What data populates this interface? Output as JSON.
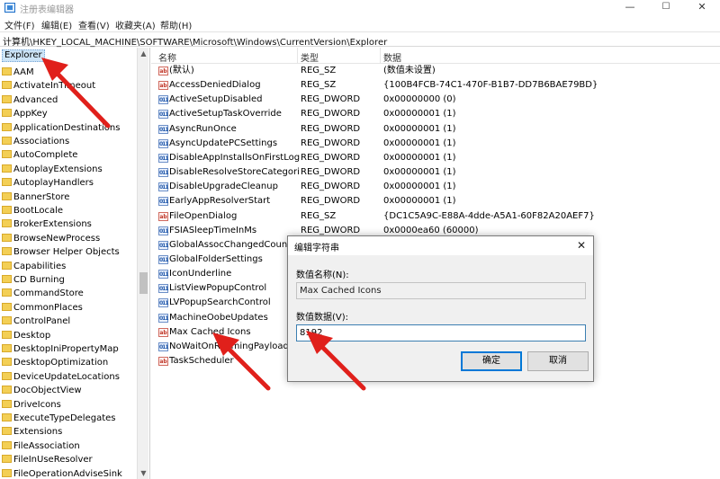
{
  "window": {
    "title": "注册表编辑器",
    "minimize": "—",
    "maximize": "☐",
    "close": "✕"
  },
  "menu": [
    "文件(F)",
    "编辑(E)",
    "查看(V)",
    "收藏夹(A)",
    "帮助(H)"
  ],
  "address": "计算机\\HKEY_LOCAL_MACHINE\\SOFTWARE\\Microsoft\\Windows\\CurrentVersion\\Explorer",
  "tree": {
    "root": "Explorer",
    "items": [
      "AAM",
      "ActivateInTimeout",
      "Advanced",
      "AppKey",
      "ApplicationDestinations",
      "Associations",
      "AutoComplete",
      "AutoplayExtensions",
      "AutoplayHandlers",
      "BannerStore",
      "BootLocale",
      "BrokerExtensions",
      "BrowseNewProcess",
      "Browser Helper Objects",
      "Capabilities",
      "CD Burning",
      "CommandStore",
      "CommonPlaces",
      "ControlPanel",
      "Desktop",
      "DesktopIniPropertyMap",
      "DesktopOptimization",
      "DeviceUpdateLocations",
      "DocObjectView",
      "DriveIcons",
      "ExecuteTypeDelegates",
      "Extensions",
      "FileAssociation",
      "FileInUseResolver",
      "FileOperationAdviseSink"
    ]
  },
  "list": {
    "headers": {
      "name": "名称",
      "type": "类型",
      "data": "数据"
    },
    "rows": [
      {
        "icon": "string-value-icon",
        "name": "(默认)",
        "type": "REG_SZ",
        "data": "(数值未设置)"
      },
      {
        "icon": "string-value-icon",
        "name": "AccessDeniedDialog",
        "type": "REG_SZ",
        "data": "{100B4FCB-74C1-470F-B1B7-DD7B6BAE79BD}"
      },
      {
        "icon": "binary-value-icon",
        "name": "ActiveSetupDisabled",
        "type": "REG_DWORD",
        "data": "0x00000000 (0)"
      },
      {
        "icon": "binary-value-icon",
        "name": "ActiveSetupTaskOverride",
        "type": "REG_DWORD",
        "data": "0x00000001 (1)"
      },
      {
        "icon": "binary-value-icon",
        "name": "AsyncRunOnce",
        "type": "REG_DWORD",
        "data": "0x00000001 (1)"
      },
      {
        "icon": "binary-value-icon",
        "name": "AsyncUpdatePCSettings",
        "type": "REG_DWORD",
        "data": "0x00000001 (1)"
      },
      {
        "icon": "binary-value-icon",
        "name": "DisableAppInstallsOnFirstLog...",
        "type": "REG_DWORD",
        "data": "0x00000001 (1)"
      },
      {
        "icon": "binary-value-icon",
        "name": "DisableResolveStoreCategori...",
        "type": "REG_DWORD",
        "data": "0x00000001 (1)"
      },
      {
        "icon": "binary-value-icon",
        "name": "DisableUpgradeCleanup",
        "type": "REG_DWORD",
        "data": "0x00000001 (1)"
      },
      {
        "icon": "binary-value-icon",
        "name": "EarlyAppResolverStart",
        "type": "REG_DWORD",
        "data": "0x00000001 (1)"
      },
      {
        "icon": "string-value-icon",
        "name": "FileOpenDialog",
        "type": "REG_SZ",
        "data": "{DC1C5A9C-E88A-4dde-A5A1-60F82A20AEF7}"
      },
      {
        "icon": "binary-value-icon",
        "name": "FSIASleepTimeInMs",
        "type": "REG_DWORD",
        "data": "0x0000ea60 (60000)"
      },
      {
        "icon": "binary-value-icon",
        "name": "GlobalAssocChangedCounter",
        "type": "",
        "data": ""
      },
      {
        "icon": "binary-value-icon",
        "name": "GlobalFolderSettings",
        "type": "",
        "data": ""
      },
      {
        "icon": "binary-value-icon",
        "name": "IconUnderline",
        "type": "",
        "data": ""
      },
      {
        "icon": "binary-value-icon",
        "name": "ListViewPopupControl",
        "type": "",
        "data": ""
      },
      {
        "icon": "binary-value-icon",
        "name": "LVPopupSearchControl",
        "type": "",
        "data": ""
      },
      {
        "icon": "binary-value-icon",
        "name": "MachineOobeUpdates",
        "type": "",
        "data": ""
      },
      {
        "icon": "string-value-icon",
        "name": "Max Cached Icons",
        "type": "",
        "data": ""
      },
      {
        "icon": "binary-value-icon",
        "name": "NoWaitOnRoamingPayloads",
        "type": "",
        "data": ""
      },
      {
        "icon": "string-value-icon",
        "name": "TaskScheduler",
        "type": "",
        "data": ""
      }
    ]
  },
  "dialog": {
    "title": "编辑字符串",
    "close": "✕",
    "name_label": "数值名称(N):",
    "name_value": "Max Cached Icons",
    "data_label": "数值数据(V):",
    "data_value": "8192",
    "ok": "确定",
    "cancel": "取消"
  },
  "colors": {
    "annotation_arrow": "#e0201b",
    "selection": "#cce4f7",
    "focus": "#0078d7"
  }
}
